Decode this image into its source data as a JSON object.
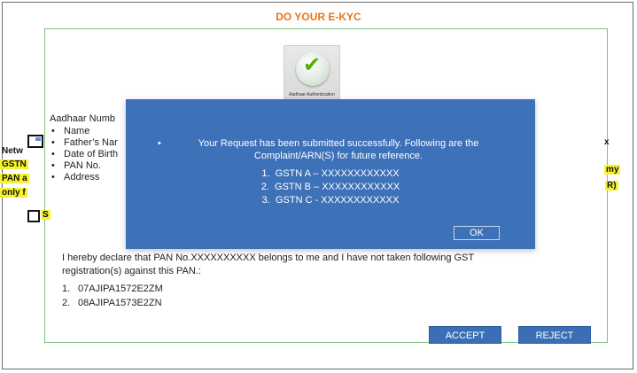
{
  "page": {
    "title": "DO YOUR E-KYC",
    "auth_tile_caption": "Aadhaar Authentication"
  },
  "details": {
    "heading": "Aadhaar Numb",
    "items": [
      "Name",
      "Father’s Nar",
      "Date of Birth",
      "PAN No.",
      "Address"
    ]
  },
  "left_labels": {
    "netw": "Netw",
    "gstn": "GSTN",
    "pan": "PAN a",
    "only": "only f",
    "s": "S"
  },
  "right_labels": {
    "x": "x",
    "my": "my",
    "r": "R)"
  },
  "declaration": {
    "line1": "I hereby declare that PAN No.XXXXXXXXXX belongs to me and I have not taken following GST",
    "line2": "registration(s) against this PAN.:",
    "gstins": [
      "07AJIPA1572E2ZM",
      "08AJIPA1573E2ZN"
    ]
  },
  "buttons": {
    "accept": "ACCEPT",
    "reject": "REJECT"
  },
  "modal": {
    "bullet": "•",
    "message_line1": "Your Request has been submitted successfully. Following are the",
    "message_line2": "Complaint/ARN(S) for future reference.",
    "arns": [
      "GSTN A – XXXXXXXXXXXX",
      "GSTN B – XXXXXXXXXXXX",
      "GSTN C - XXXXXXXXXXXX"
    ],
    "ok_label": "OK"
  },
  "colors": {
    "title": "#e8751a",
    "modal_bg": "#3d71b8",
    "button_bg": "#3a6fb6",
    "highlight": "#f5f230",
    "panel_border": "#7cc27c"
  },
  "icons": {
    "auth": "checkmark-icon"
  }
}
